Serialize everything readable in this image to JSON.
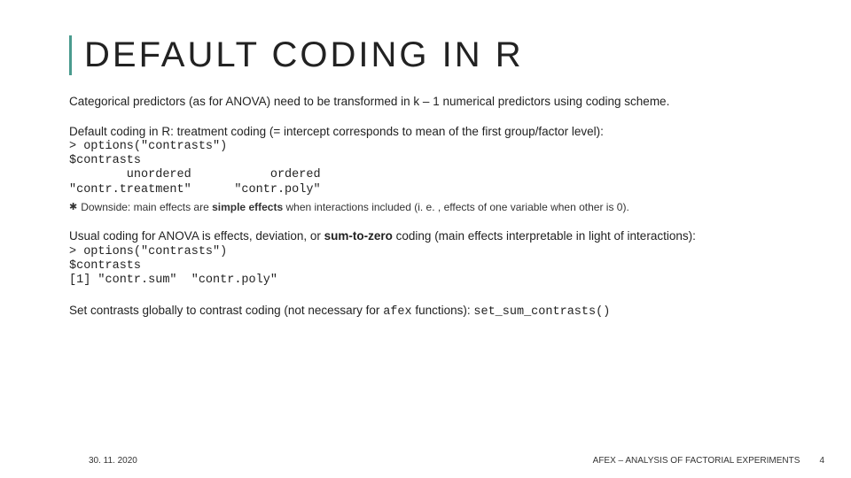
{
  "title": "DEFAULT CODING IN R",
  "p1": "Categorical predictors (as for ANOVA) need to be transformed in k – 1 numerical predictors using coding scheme.",
  "p2": "Default coding in R: treatment coding (= intercept corresponds to mean of the first group/factor level):",
  "code1_l1": "> options(\"contrasts\")",
  "code1_l2": "$contrasts",
  "code1_l3": "        unordered           ordered",
  "code1_l4": "\"contr.treatment\"      \"contr.poly\"",
  "downside_lead": "Downside: ",
  "downside_mid": "main effects are ",
  "downside_bold": "simple effects",
  "downside_tail": " when interactions included (i. e. , effects of one variable when other is 0).",
  "p3_a": "Usual coding for ANOVA is effects, deviation, or ",
  "p3_bold": "sum-to-zero",
  "p3_b": " coding (main effects interpretable in light of interactions):",
  "code2_l1": "> options(\"contrasts\")",
  "code2_l2": "$contrasts",
  "code2_l3": "[1] \"contr.sum\"  \"contr.poly\"",
  "p4_a": "Set contrasts globally to contrast coding (not necessary for ",
  "p4_mono1": "afex",
  "p4_b": " functions): ",
  "p4_mono2": "set_sum_contrasts()",
  "footer_date": "30. 11. 2020",
  "footer_label": "AFEX – ANALYSIS OF FACTORIAL EXPERIMENTS",
  "footer_page": "4"
}
